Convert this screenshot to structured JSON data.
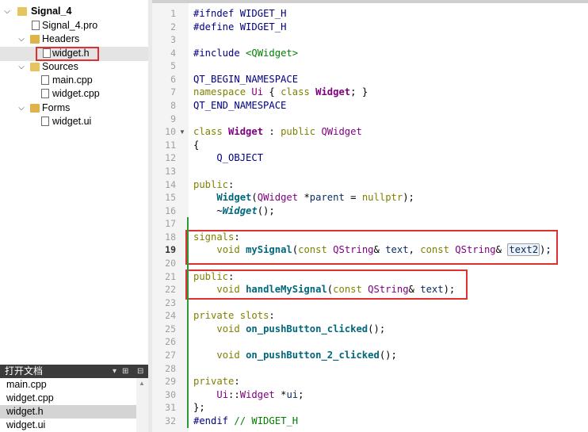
{
  "project_tree": {
    "project_name": "Signal_4",
    "pro_file": "Signal_4.pro",
    "headers_label": "Headers",
    "header_file": "widget.h",
    "sources_label": "Sources",
    "source_files": [
      "main.cpp",
      "widget.cpp"
    ],
    "forms_label": "Forms",
    "form_file": "widget.ui"
  },
  "open_documents": {
    "title": "打开文档",
    "items": [
      "main.cpp",
      "widget.cpp",
      "widget.h",
      "widget.ui"
    ],
    "active": "widget.h"
  },
  "editor": {
    "current_line": 19,
    "lines": [
      {
        "n": "1",
        "t": "#ifndef WIDGET_H"
      },
      {
        "n": "2",
        "t": "#define WIDGET_H"
      },
      {
        "n": "3",
        "t": ""
      },
      {
        "n": "4",
        "t": "#include <QWidget>"
      },
      {
        "n": "5",
        "t": ""
      },
      {
        "n": "6",
        "t": "QT_BEGIN_NAMESPACE"
      },
      {
        "n": "7",
        "t": "namespace Ui { class Widget; }"
      },
      {
        "n": "8",
        "t": "QT_END_NAMESPACE"
      },
      {
        "n": "9",
        "t": ""
      },
      {
        "n": "10",
        "t": "class Widget : public QWidget"
      },
      {
        "n": "11",
        "t": "{"
      },
      {
        "n": "12",
        "t": "    Q_OBJECT"
      },
      {
        "n": "13",
        "t": ""
      },
      {
        "n": "14",
        "t": "public:"
      },
      {
        "n": "15",
        "t": "    Widget(QWidget *parent = nullptr);"
      },
      {
        "n": "16",
        "t": "    ~Widget();"
      },
      {
        "n": "17",
        "t": ""
      },
      {
        "n": "18",
        "t": "signals:"
      },
      {
        "n": "19",
        "t": "    void mySignal(const QString& text, const QString& text2);"
      },
      {
        "n": "20",
        "t": ""
      },
      {
        "n": "21",
        "t": "public:"
      },
      {
        "n": "22",
        "t": "    void handleMySignal(const QString& text);"
      },
      {
        "n": "23",
        "t": ""
      },
      {
        "n": "24",
        "t": "private slots:"
      },
      {
        "n": "25",
        "t": "    void on_pushButton_clicked();"
      },
      {
        "n": "26",
        "t": ""
      },
      {
        "n": "27",
        "t": "    void on_pushButton_2_clicked();"
      },
      {
        "n": "28",
        "t": ""
      },
      {
        "n": "29",
        "t": "private:"
      },
      {
        "n": "30",
        "t": "    Ui::Widget *ui;"
      },
      {
        "n": "31",
        "t": "};"
      },
      {
        "n": "32",
        "t": "#endif // WIDGET_H"
      }
    ],
    "colors": {
      "keyword": "#808000",
      "type": "#800080",
      "function": "#00677c",
      "preprocessor": "#000080",
      "annotation_box": "#e03030",
      "change_marker": "#2a9a3a"
    }
  }
}
